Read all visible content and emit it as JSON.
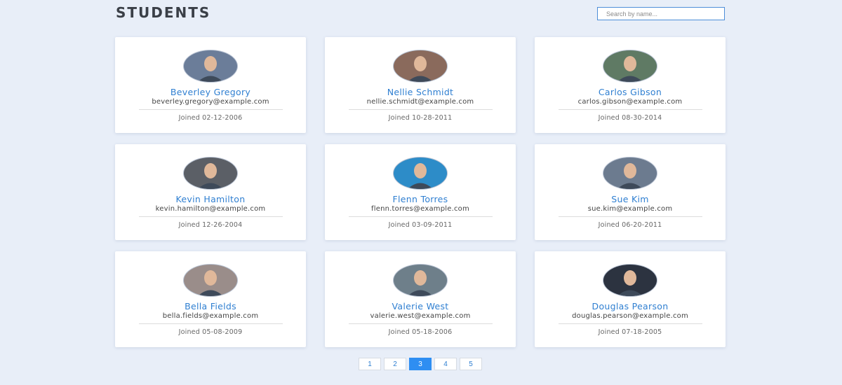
{
  "header": {
    "title": "STUDENTS"
  },
  "search": {
    "placeholder": "Search by name..."
  },
  "students": [
    {
      "name": "Beverley Gregory",
      "email": "beverley.gregory@example.com",
      "joined": "Joined 02-12-2006",
      "avatar_color": "#6b7d99"
    },
    {
      "name": "Nellie Schmidt",
      "email": "nellie.schmidt@example.com",
      "joined": "Joined 10-28-2011",
      "avatar_color": "#8a6a5c"
    },
    {
      "name": "Carlos Gibson",
      "email": "carlos.gibson@example.com",
      "joined": "Joined 08-30-2014",
      "avatar_color": "#5f7a64"
    },
    {
      "name": "Kevin Hamilton",
      "email": "kevin.hamilton@example.com",
      "joined": "Joined 12-26-2004",
      "avatar_color": "#5b5f66"
    },
    {
      "name": "Flenn Torres",
      "email": "flenn.torres@example.com",
      "joined": "Joined 03-09-2011",
      "avatar_color": "#2d8cc8"
    },
    {
      "name": "Sue Kim",
      "email": "sue.kim@example.com",
      "joined": "Joined 06-20-2011",
      "avatar_color": "#6c7b8f"
    },
    {
      "name": "Bella Fields",
      "email": "bella.fields@example.com",
      "joined": "Joined 05-08-2009",
      "avatar_color": "#9a8d8a"
    },
    {
      "name": "Valerie West",
      "email": "valerie.west@example.com",
      "joined": "Joined 05-18-2006",
      "avatar_color": "#6e7f8a"
    },
    {
      "name": "Douglas Pearson",
      "email": "douglas.pearson@example.com",
      "joined": "Joined 07-18-2005",
      "avatar_color": "#2c3340"
    }
  ],
  "pagination": {
    "pages": [
      "1",
      "2",
      "3",
      "4",
      "5"
    ],
    "active": "3"
  },
  "colors": {
    "accent": "#2e8ef2",
    "name_link": "#2f7fd1",
    "background": "#e8eef8"
  }
}
